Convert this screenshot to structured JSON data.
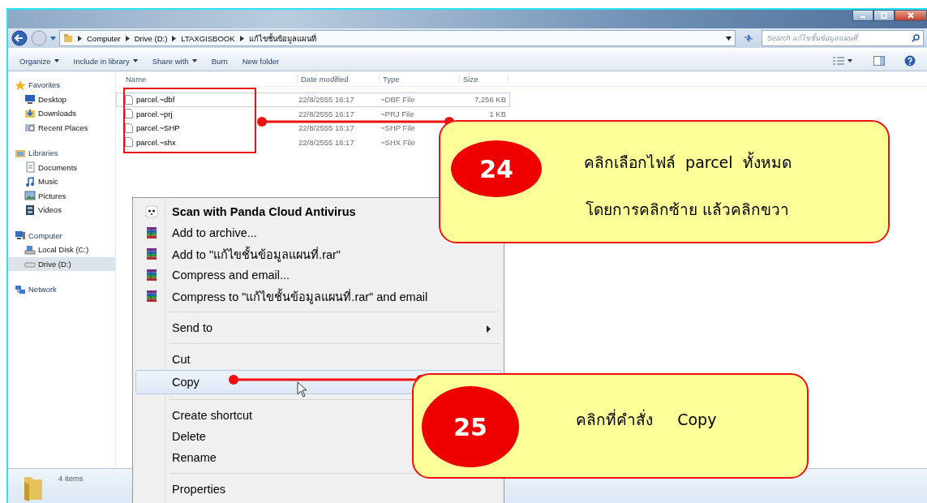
{
  "explorer": {
    "breadcrumb": [
      "Computer",
      "Drive (D:)",
      "LTAXGISBOOK",
      "แก้ไขชั้นข้อมูลแผนที่"
    ],
    "search": {
      "placeholder": "Search แก้ไขชั้นข้อมูลแผนที่"
    },
    "toolbar": [
      {
        "label": "Organize",
        "dropdown": true
      },
      {
        "label": "Include in library",
        "dropdown": true
      },
      {
        "label": "Share with",
        "dropdown": true
      },
      {
        "label": "Burn",
        "dropdown": false
      },
      {
        "label": "New folder",
        "dropdown": false
      }
    ],
    "sidebar": [
      {
        "label": "Favorites",
        "kind": "star",
        "selected": false,
        "children": [
          {
            "label": "Desktop",
            "kind": "desktop",
            "selected": false
          },
          {
            "label": "Downloads",
            "kind": "downloads",
            "selected": false
          },
          {
            "label": "Recent Places",
            "kind": "recent",
            "selected": false
          }
        ]
      },
      {
        "label": "Libraries",
        "kind": "library",
        "selected": false,
        "children": [
          {
            "label": "Documents",
            "kind": "documents",
            "selected": false
          },
          {
            "label": "Music",
            "kind": "music",
            "selected": false
          },
          {
            "label": "Pictures",
            "kind": "pictures",
            "selected": false
          },
          {
            "label": "Videos",
            "kind": "videos",
            "selected": false
          }
        ]
      },
      {
        "label": "Computer",
        "kind": "computer",
        "selected": false,
        "children": [
          {
            "label": "Local Disk (C:)",
            "kind": "disk",
            "selected": false
          },
          {
            "label": "Drive (D:)",
            "kind": "drive",
            "selected": true
          }
        ]
      },
      {
        "label": "Network",
        "kind": "network",
        "selected": false
      }
    ],
    "columns": [
      "Name",
      "Date modified",
      "Type",
      "Size"
    ],
    "files": [
      {
        "name": "parcel.~dbf",
        "date": "22/8/2555 16:17",
        "type": "~DBF File",
        "size": "7,256 KB",
        "focused": true
      },
      {
        "name": "parcel.~prj",
        "date": "22/8/2555 16:17",
        "type": "~PRJ File",
        "size": "1 KB",
        "focused": false
      },
      {
        "name": "parcel.~SHP",
        "date": "22/8/2555 16:17",
        "type": "~SHP File",
        "focused": false
      },
      {
        "name": "parcel.~shx",
        "date": "22/8/2555 16:17",
        "type": "~SHX File",
        "focused": false
      }
    ],
    "status": "4 items"
  },
  "context_menu": [
    {
      "label": "Scan with Panda Cloud Antivirus",
      "kind": "panda",
      "bold": true,
      "selected": false,
      "separator_above": false
    },
    {
      "label": "Add to archive...",
      "kind": "rar",
      "bold": false,
      "selected": false,
      "separator_above": false
    },
    {
      "label": "Add to \"แก้ไขชั้นข้อมูลแผนที่.rar\"",
      "kind": "rar",
      "bold": false,
      "selected": false,
      "separator_above": false
    },
    {
      "label": "Compress and email...",
      "kind": "rar",
      "bold": false,
      "selected": false,
      "separator_above": false
    },
    {
      "label": "Compress to \"แก้ไขชั้นข้อมูลแผนที่.rar\" and email",
      "kind": "rar",
      "bold": false,
      "selected": false,
      "separator_above": false
    },
    {
      "label": "Send to",
      "kind": "submenu",
      "bold": false,
      "selected": false,
      "separator_above": true
    },
    {
      "label": "Cut",
      "kind": "plain",
      "bold": false,
      "selected": false,
      "separator_above": true
    },
    {
      "label": "Copy",
      "kind": "plain",
      "bold": false,
      "selected": true,
      "separator_above": false
    },
    {
      "label": "Create shortcut",
      "kind": "plain",
      "bold": false,
      "selected": false,
      "separator_above": true
    },
    {
      "label": "Delete",
      "kind": "plain",
      "bold": false,
      "selected": false,
      "separator_above": false
    },
    {
      "label": "Rename",
      "kind": "plain",
      "bold": false,
      "selected": false,
      "separator_above": false
    },
    {
      "label": "Properties",
      "kind": "plain",
      "bold": false,
      "selected": false,
      "separator_above": true
    }
  ],
  "callouts": [
    {
      "number": "24",
      "lines": [
        "คลิกเลือกไฟล์  parcel  ทั้งหมด",
        "โดยการคลิกซ้าย แล้วคลิกขวา"
      ]
    },
    {
      "number": "25",
      "lines": [
        "คลิกที่คำสั่ง     Copy"
      ]
    }
  ]
}
